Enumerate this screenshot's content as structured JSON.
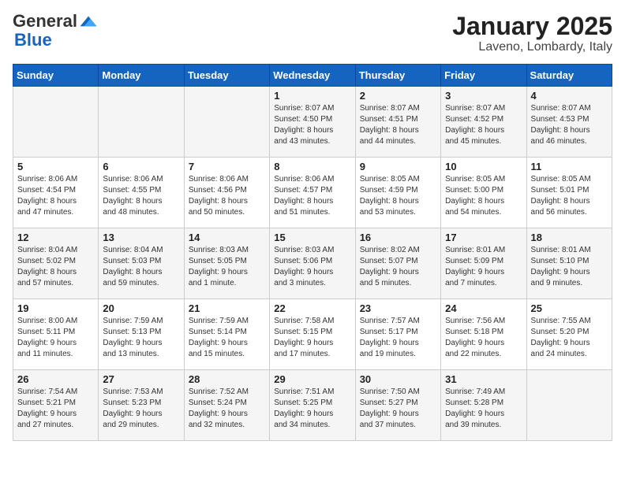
{
  "header": {
    "logo_general": "General",
    "logo_blue": "Blue",
    "month": "January 2025",
    "location": "Laveno, Lombardy, Italy"
  },
  "days_of_week": [
    "Sunday",
    "Monday",
    "Tuesday",
    "Wednesday",
    "Thursday",
    "Friday",
    "Saturday"
  ],
  "weeks": [
    [
      {
        "day": "",
        "info": ""
      },
      {
        "day": "",
        "info": ""
      },
      {
        "day": "",
        "info": ""
      },
      {
        "day": "1",
        "info": "Sunrise: 8:07 AM\nSunset: 4:50 PM\nDaylight: 8 hours\nand 43 minutes."
      },
      {
        "day": "2",
        "info": "Sunrise: 8:07 AM\nSunset: 4:51 PM\nDaylight: 8 hours\nand 44 minutes."
      },
      {
        "day": "3",
        "info": "Sunrise: 8:07 AM\nSunset: 4:52 PM\nDaylight: 8 hours\nand 45 minutes."
      },
      {
        "day": "4",
        "info": "Sunrise: 8:07 AM\nSunset: 4:53 PM\nDaylight: 8 hours\nand 46 minutes."
      }
    ],
    [
      {
        "day": "5",
        "info": "Sunrise: 8:06 AM\nSunset: 4:54 PM\nDaylight: 8 hours\nand 47 minutes."
      },
      {
        "day": "6",
        "info": "Sunrise: 8:06 AM\nSunset: 4:55 PM\nDaylight: 8 hours\nand 48 minutes."
      },
      {
        "day": "7",
        "info": "Sunrise: 8:06 AM\nSunset: 4:56 PM\nDaylight: 8 hours\nand 50 minutes."
      },
      {
        "day": "8",
        "info": "Sunrise: 8:06 AM\nSunset: 4:57 PM\nDaylight: 8 hours\nand 51 minutes."
      },
      {
        "day": "9",
        "info": "Sunrise: 8:05 AM\nSunset: 4:59 PM\nDaylight: 8 hours\nand 53 minutes."
      },
      {
        "day": "10",
        "info": "Sunrise: 8:05 AM\nSunset: 5:00 PM\nDaylight: 8 hours\nand 54 minutes."
      },
      {
        "day": "11",
        "info": "Sunrise: 8:05 AM\nSunset: 5:01 PM\nDaylight: 8 hours\nand 56 minutes."
      }
    ],
    [
      {
        "day": "12",
        "info": "Sunrise: 8:04 AM\nSunset: 5:02 PM\nDaylight: 8 hours\nand 57 minutes."
      },
      {
        "day": "13",
        "info": "Sunrise: 8:04 AM\nSunset: 5:03 PM\nDaylight: 8 hours\nand 59 minutes."
      },
      {
        "day": "14",
        "info": "Sunrise: 8:03 AM\nSunset: 5:05 PM\nDaylight: 9 hours\nand 1 minute."
      },
      {
        "day": "15",
        "info": "Sunrise: 8:03 AM\nSunset: 5:06 PM\nDaylight: 9 hours\nand 3 minutes."
      },
      {
        "day": "16",
        "info": "Sunrise: 8:02 AM\nSunset: 5:07 PM\nDaylight: 9 hours\nand 5 minutes."
      },
      {
        "day": "17",
        "info": "Sunrise: 8:01 AM\nSunset: 5:09 PM\nDaylight: 9 hours\nand 7 minutes."
      },
      {
        "day": "18",
        "info": "Sunrise: 8:01 AM\nSunset: 5:10 PM\nDaylight: 9 hours\nand 9 minutes."
      }
    ],
    [
      {
        "day": "19",
        "info": "Sunrise: 8:00 AM\nSunset: 5:11 PM\nDaylight: 9 hours\nand 11 minutes."
      },
      {
        "day": "20",
        "info": "Sunrise: 7:59 AM\nSunset: 5:13 PM\nDaylight: 9 hours\nand 13 minutes."
      },
      {
        "day": "21",
        "info": "Sunrise: 7:59 AM\nSunset: 5:14 PM\nDaylight: 9 hours\nand 15 minutes."
      },
      {
        "day": "22",
        "info": "Sunrise: 7:58 AM\nSunset: 5:15 PM\nDaylight: 9 hours\nand 17 minutes."
      },
      {
        "day": "23",
        "info": "Sunrise: 7:57 AM\nSunset: 5:17 PM\nDaylight: 9 hours\nand 19 minutes."
      },
      {
        "day": "24",
        "info": "Sunrise: 7:56 AM\nSunset: 5:18 PM\nDaylight: 9 hours\nand 22 minutes."
      },
      {
        "day": "25",
        "info": "Sunrise: 7:55 AM\nSunset: 5:20 PM\nDaylight: 9 hours\nand 24 minutes."
      }
    ],
    [
      {
        "day": "26",
        "info": "Sunrise: 7:54 AM\nSunset: 5:21 PM\nDaylight: 9 hours\nand 27 minutes."
      },
      {
        "day": "27",
        "info": "Sunrise: 7:53 AM\nSunset: 5:23 PM\nDaylight: 9 hours\nand 29 minutes."
      },
      {
        "day": "28",
        "info": "Sunrise: 7:52 AM\nSunset: 5:24 PM\nDaylight: 9 hours\nand 32 minutes."
      },
      {
        "day": "29",
        "info": "Sunrise: 7:51 AM\nSunset: 5:25 PM\nDaylight: 9 hours\nand 34 minutes."
      },
      {
        "day": "30",
        "info": "Sunrise: 7:50 AM\nSunset: 5:27 PM\nDaylight: 9 hours\nand 37 minutes."
      },
      {
        "day": "31",
        "info": "Sunrise: 7:49 AM\nSunset: 5:28 PM\nDaylight: 9 hours\nand 39 minutes."
      },
      {
        "day": "",
        "info": ""
      }
    ]
  ]
}
